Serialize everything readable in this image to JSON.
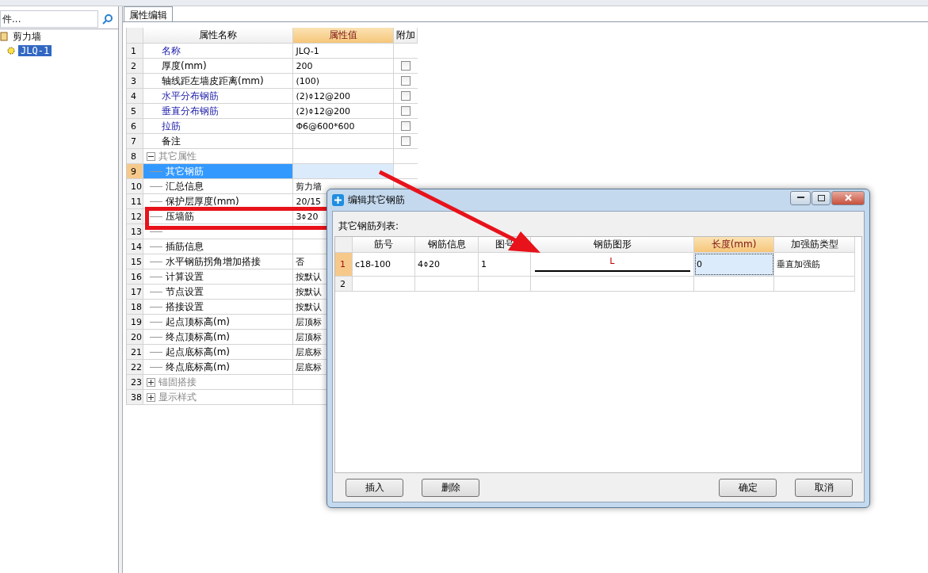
{
  "sidebar": {
    "search": {
      "placeholder": "件..."
    },
    "tree": [
      {
        "label": "剪力墙",
        "selected": false,
        "children": [
          {
            "label": "JLQ-1",
            "selected": true
          }
        ]
      }
    ]
  },
  "tabs": [
    {
      "label": "属性编辑",
      "selected": true
    }
  ],
  "grid": {
    "columns": [
      "属性名称",
      "属性值",
      "附加"
    ],
    "rows": [
      {
        "kind": "field",
        "num": "1",
        "name": "名称",
        "value": "JLQ-1",
        "linked": true,
        "selected": false
      },
      {
        "kind": "field",
        "num": "2",
        "name": "厚度(mm)",
        "value": "200",
        "linked": false,
        "selected": false,
        "checked": false
      },
      {
        "kind": "field",
        "num": "3",
        "name": "轴线距左墙皮距离(mm)",
        "value": "(100)",
        "linked": false,
        "selected": false,
        "checked": false
      },
      {
        "kind": "field",
        "num": "4",
        "name": "水平分布钢筋",
        "value": "(2)⌽12@200",
        "linked": true,
        "selected": false,
        "checked": false
      },
      {
        "kind": "field",
        "num": "5",
        "name": "垂直分布钢筋",
        "value": "(2)⌽12@200",
        "linked": true,
        "selected": false,
        "checked": false
      },
      {
        "kind": "field",
        "num": "6",
        "name": "拉筋",
        "value": "Φ6@600*600",
        "linked": true,
        "selected": false,
        "checked": false
      },
      {
        "kind": "field",
        "num": "7",
        "name": "备注",
        "value": "",
        "linked": false,
        "selected": false,
        "checked": false
      },
      {
        "kind": "group",
        "num": "8",
        "name": "其它属性",
        "expanded": true,
        "selected": false,
        "children": [
          {
            "kind": "field",
            "num": "9",
            "name": "其它钢筋",
            "selected": true
          },
          {
            "kind": "field",
            "num": "10",
            "name": "汇总信息",
            "value": "剪力墙",
            "selected": false
          },
          {
            "kind": "field",
            "num": "11",
            "name": "保护层厚度(mm)",
            "value": "20/15",
            "selected": false
          },
          {
            "kind": "field",
            "num": "12",
            "name": "压墙筋",
            "value": "3⌽20",
            "selected": false
          },
          {
            "kind": "field",
            "num": "13",
            "selected": false
          },
          {
            "kind": "field",
            "num": "14",
            "name": "插筋信息",
            "selected": false
          },
          {
            "kind": "field",
            "num": "15",
            "name": "水平钢筋拐角增加搭接",
            "value": "否",
            "selected": false
          },
          {
            "kind": "field",
            "num": "16",
            "name": "计算设置",
            "value": "按默认",
            "selected": false
          },
          {
            "kind": "field",
            "num": "17",
            "name": "节点设置",
            "value": "按默认",
            "selected": false
          },
          {
            "kind": "field",
            "num": "18",
            "name": "搭接设置",
            "value": "按默认",
            "selected": false
          },
          {
            "kind": "field",
            "num": "19",
            "name": "起点顶标高(m)",
            "value": "层顶标",
            "selected": false
          },
          {
            "kind": "field",
            "num": "20",
            "name": "终点顶标高(m)",
            "value": "层顶标",
            "selected": false
          },
          {
            "kind": "field",
            "num": "21",
            "name": "起点底标高(m)",
            "value": "层底标",
            "selected": false
          },
          {
            "kind": "field",
            "num": "22",
            "name": "终点底标高(m)",
            "value": "层底标",
            "selected": false
          }
        ]
      },
      {
        "kind": "group",
        "num": "23",
        "name": "锚固搭接",
        "expanded": false,
        "selected": false
      },
      {
        "kind": "group",
        "num": "38",
        "name": "显示样式",
        "expanded": false,
        "selected": false
      }
    ]
  },
  "dialog": {
    "title": "编辑其它钢筋",
    "list_label": "其它钢筋列表:",
    "columns": [
      {
        "label": "筋号",
        "selected": false
      },
      {
        "label": "钢筋信息",
        "selected": false
      },
      {
        "label": "图号",
        "selected": false
      },
      {
        "label": "钢筋图形",
        "selected": false
      },
      {
        "label": "长度(mm)",
        "selected": true
      },
      {
        "label": "加强筋类型",
        "selected": false
      }
    ],
    "rows": [
      {
        "num": "1",
        "selected": true,
        "cells": [
          "c18-100",
          "4⌽20",
          "1",
          {
            "shape_label": "L"
          },
          "0",
          "垂直加强筋"
        ]
      },
      {
        "num": "2",
        "selected": false,
        "cells": [
          "",
          "",
          "",
          "",
          "",
          ""
        ]
      }
    ],
    "buttons_left": [
      "插入",
      "删除"
    ],
    "buttons_right": [
      "确定",
      "取消"
    ]
  }
}
